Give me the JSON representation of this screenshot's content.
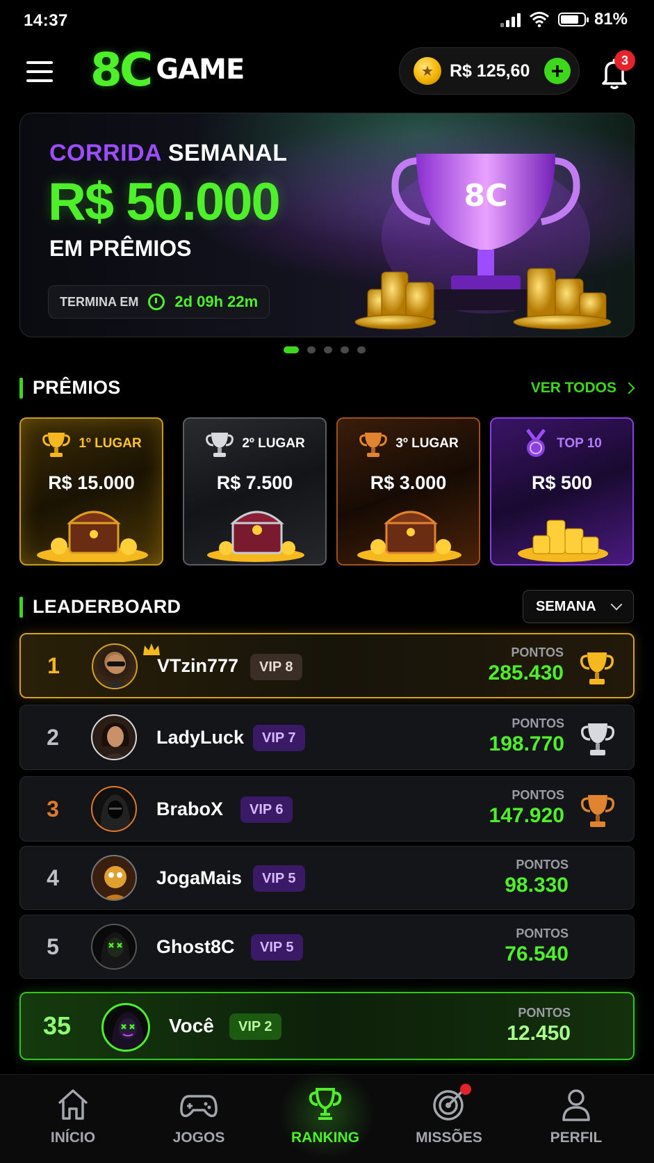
{
  "status_bar": {
    "time": "14:37",
    "battery": "81%"
  },
  "header": {
    "logo_mark": "8C",
    "logo_text": "GAME",
    "balance": "R$ 125,60",
    "notifications": "3"
  },
  "banner": {
    "title_part1": "CORRIDA",
    "title_part2": "SEMANAL",
    "amount": "R$ 50.000",
    "subtitle": "EM PRÊMIOS",
    "ends_label": "TERMINA EM",
    "countdown": "2d 09h 22m",
    "trophy_mark": "8C"
  },
  "prizes": {
    "title": "PRÊMIOS",
    "see_all": "VER TODOS",
    "items": [
      {
        "place": "1º LUGAR",
        "value": "R$ 15.000"
      },
      {
        "place": "2º LUGAR",
        "value": "R$ 7.500"
      },
      {
        "place": "3º LUGAR",
        "value": "R$ 3.000"
      },
      {
        "place": "TOP 10",
        "value": "R$ 500"
      }
    ]
  },
  "leaderboard": {
    "title": "LEADERBOARD",
    "period": "SEMANA",
    "points_label": "PONTOS",
    "rows": [
      {
        "rank": "1",
        "name": "VTzin777",
        "vip": "VIP 8",
        "points": "285.430"
      },
      {
        "rank": "2",
        "name": "LadyLuck",
        "vip": "VIP 7",
        "points": "198.770"
      },
      {
        "rank": "3",
        "name": "BraboX",
        "vip": "VIP 6",
        "points": "147.920"
      },
      {
        "rank": "4",
        "name": "JogaMais",
        "vip": "VIP 5",
        "points": "98.330"
      },
      {
        "rank": "5",
        "name": "Ghost8C",
        "vip": "VIP 5",
        "points": "76.540"
      }
    ],
    "me": {
      "rank": "35",
      "name": "Você",
      "vip": "VIP 2",
      "points": "12.450"
    }
  },
  "nav": {
    "items": [
      {
        "label": "INÍCIO",
        "icon": "home-icon"
      },
      {
        "label": "JOGOS",
        "icon": "gamepad-icon"
      },
      {
        "label": "RANKING",
        "icon": "trophy-icon"
      },
      {
        "label": "MISSÕES",
        "icon": "target-icon"
      },
      {
        "label": "PERFIL",
        "icon": "user-icon"
      }
    ]
  },
  "colors": {
    "accent": "#4ef02a",
    "purple": "#9b4dff",
    "gold": "#d5a21f",
    "background": "#000000"
  }
}
